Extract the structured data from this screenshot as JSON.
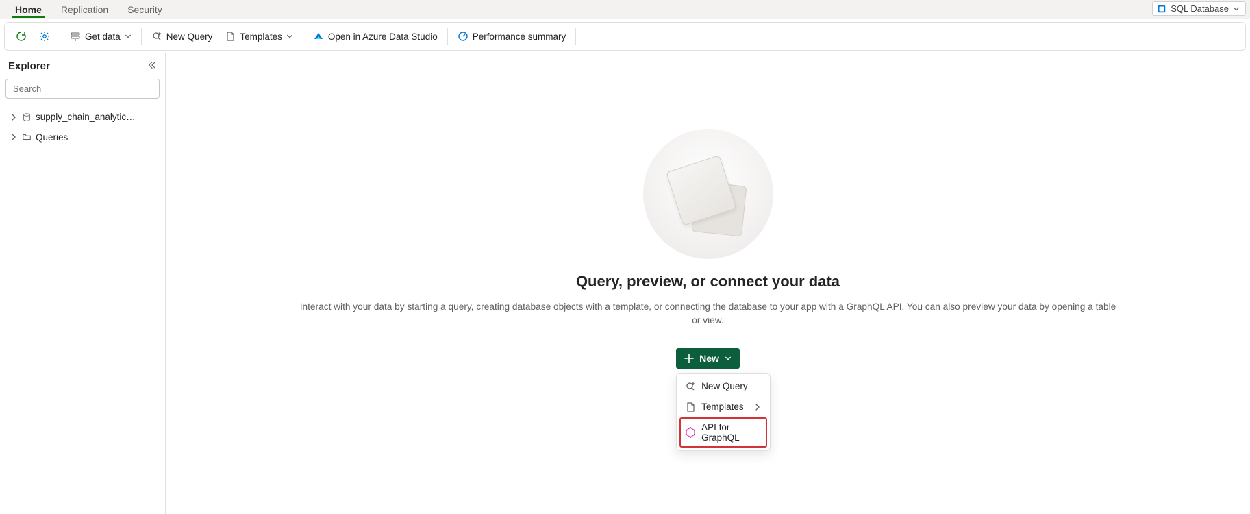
{
  "tabs": {
    "home": "Home",
    "replication": "Replication",
    "security": "Security"
  },
  "db_badge": {
    "label": "SQL Database"
  },
  "toolbar": {
    "get_data": "Get data",
    "new_query": "New Query",
    "templates": "Templates",
    "open_azure": "Open in Azure Data Studio",
    "perf_summary": "Performance summary"
  },
  "sidebar": {
    "title": "Explorer",
    "search_placeholder": "Search",
    "items": [
      {
        "label": "supply_chain_analytics..."
      },
      {
        "label": "Queries"
      }
    ]
  },
  "hero": {
    "title": "Query, preview, or connect your data",
    "desc": "Interact with your data by starting a query, creating database objects with a template, or connecting the database to your app with a GraphQL API. You can also preview your data by opening a table or view.",
    "new_label": "New"
  },
  "new_menu": {
    "new_query": "New Query",
    "templates": "Templates",
    "api_graphql": "API for GraphQL"
  }
}
